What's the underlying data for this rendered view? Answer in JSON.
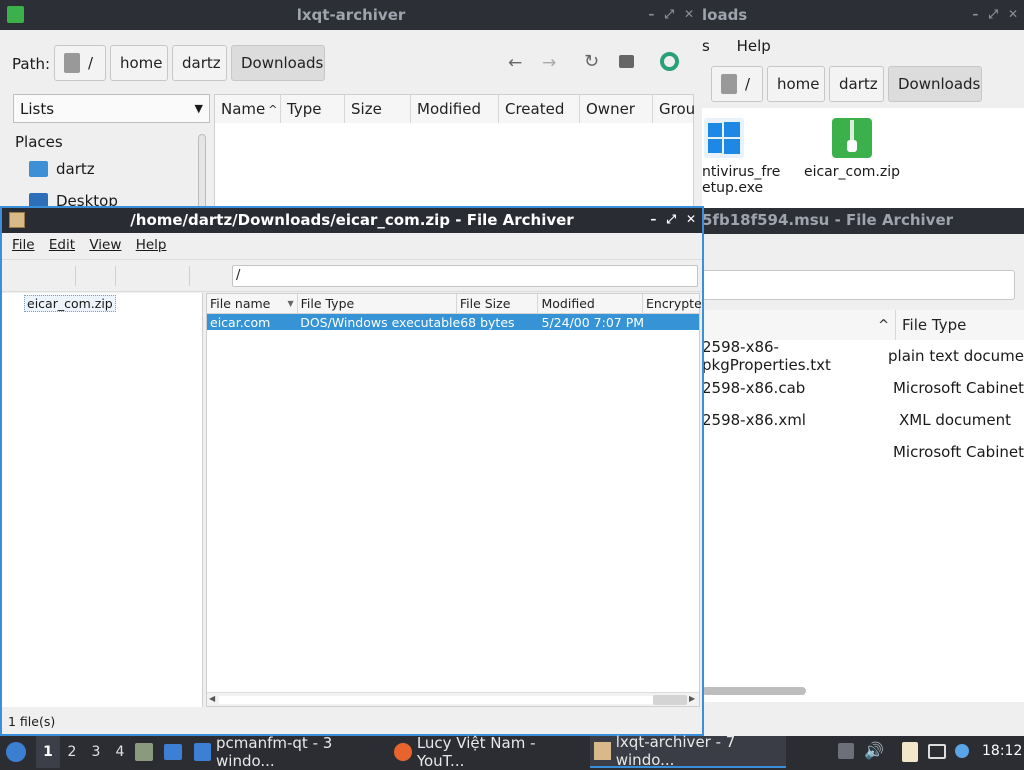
{
  "bg_window_1": {
    "title": "lxqt-archiver",
    "path_label": "Path:",
    "breadcrumbs": [
      "/",
      "home",
      "dartz",
      "Downloads"
    ],
    "view_select": "Lists",
    "places_header": "Places",
    "places": [
      "dartz",
      "Desktop"
    ],
    "columns": [
      "Name",
      "Type",
      "Size",
      "Modified",
      "Created",
      "Owner",
      "Grou"
    ]
  },
  "bg_window_2": {
    "title_tail": "loads",
    "menu_tail": [
      "s",
      "Help"
    ],
    "breadcrumbs": [
      "/",
      "home",
      "dartz",
      "Downloads"
    ],
    "files": [
      {
        "label_line1": "ntivirus_fre",
        "label_line2": "etup.exe",
        "icon": "windows-installer-icon"
      },
      {
        "label_line1": "eicar_com.zip",
        "label_line2": "",
        "icon": "zip-archive-icon"
      }
    ]
  },
  "bg_window_3": {
    "title_tail": "5fb18f594.msu - File Archiver",
    "column_type": "File Type",
    "rows": [
      {
        "name": "2598-x86-pkgProperties.txt",
        "type": "plain text docume"
      },
      {
        "name": "2598-x86.cab",
        "type": "Microsoft Cabinet"
      },
      {
        "name": "2598-x86.xml",
        "type": "XML document"
      },
      {
        "name": "",
        "type": "Microsoft Cabinet"
      }
    ]
  },
  "archiver": {
    "title": "/home/dartz/Downloads/eicar_com.zip - File Archiver",
    "menu": [
      "File",
      "Edit",
      "View",
      "Help"
    ],
    "location": "/",
    "tree_root": "eicar_com.zip",
    "columns": [
      "File name",
      "File Type",
      "File Size",
      "Modified",
      "Encrypte"
    ],
    "rows": [
      {
        "name": "eicar.com",
        "type": "DOS/Windows executable",
        "size": "68 bytes",
        "modified": "5/24/00 7:07 PM"
      }
    ],
    "status": "1 file(s)"
  },
  "taskbar": {
    "desktops": [
      "1",
      "2",
      "3",
      "4"
    ],
    "tasks": [
      "pcmanfm-qt - 3 windo...",
      "Lucy Việt Nam - YouT...",
      "lxqt-archiver - 7 windo..."
    ],
    "clock": "18:12"
  },
  "colors": {
    "selection": "#3593d6",
    "accent_border": "#3a8fd8",
    "titlebar": "#2a2c33",
    "zip_green": "#3cb04a",
    "windows_blue": "#1e88e5"
  }
}
